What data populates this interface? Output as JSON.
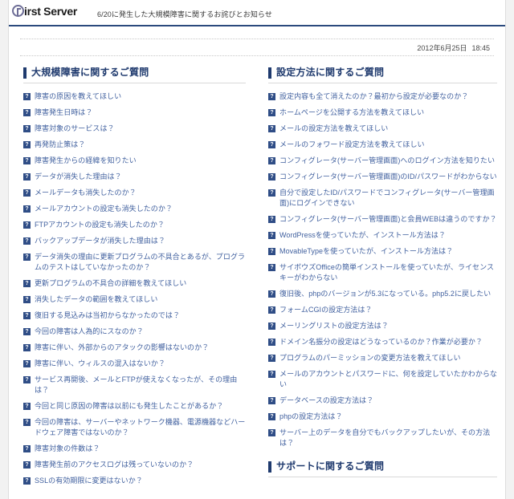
{
  "header": {
    "brand_mark": "first-server-logo",
    "brand_text": "irst Server",
    "title": "6/20に発生した大規模障害に関するお詫びとお知らせ"
  },
  "meta": {
    "date": "2012年6月25日",
    "time": "18:45"
  },
  "icons": {
    "question": "?"
  },
  "sections": {
    "outage": {
      "title": "大規模障害に関するご質問",
      "items": [
        "障害の原因を教えてほしい",
        "障害発生日時は？",
        "障害対象のサービスは？",
        "再発防止策は？",
        "障害発生からの経緯を知りたい",
        "データが消失した理由は？",
        "メールデータも消失したのか？",
        "メールアカウントの設定も消失したのか？",
        "FTPアカウントの設定も消失したのか？",
        "バックアップデータが消失した理由は？",
        "データ消失の理由に更新プログラムの不具合とあるが、プログラムのテストはしていなかったのか？",
        "更新プログラムの不具合の詳細を教えてほしい",
        "消失したデータの範囲を教えてほしい",
        "復旧する見込みは当初からなかったのでは？",
        "今回の障害は人為的にスなのか？",
        "障害に伴い、外部からのアタックの影響はないのか？",
        "障害に伴い、ウィルスの混入はないか？",
        "サービス再開後、メールとFTPが使えなくなったが、その理由は？",
        "今回と同じ原因の障害は以前にも発生したことがあるか？",
        "今回の障害は、サーバーやネットワーク機器、電源機器などハードウェア障害ではないのか？",
        "障害対象の件数は？",
        "障害発生前のアクセスログは残っていないのか？",
        "SSLの有効期限に変更はないか？"
      ]
    },
    "settings": {
      "title": "設定方法に関するご質問",
      "items": [
        "設定内容も全て消えたのか？最初から設定が必要なのか？",
        "ホームページを公開する方法を教えてほしい",
        "メールの設定方法を教えてほしい",
        "メールのフォワード設定方法を教えてほしい",
        "コンフィグレータ(サーバー管理画面)へのログイン方法を知りたい",
        "コンフィグレータ(サーバー管理画面)のID/パスワードがわからない",
        "自分で設定したID/パスワードでコンフィグレータ(サーバー管理画面)にログインできない",
        "コンフィグレータ(サーバー管理画面)と会員WEBは違うのですか？",
        "WordPressを使っていたが、インストール方法は？",
        "MovableTypeを使っていたが、インストール方法は？",
        "サイボウズOfficeの簡単インストールを使っていたが、ライセンスキーがわからない",
        "復旧後、phpのバージョンが5.3になっている。php5.2に戻したい",
        "フォームCGIの設定方法は？",
        "メーリングリストの設定方法は？",
        "ドメイン名振分の設定はどうなっているのか？作業が必要か？",
        "プログラムのパーミッションの変更方法を教えてほしい",
        "メールのアカウントとパスワードに、何を設定していたかわからない",
        "データベースの設定方法は？",
        "phpの設定方法は？",
        "サーバー上のデータを自分でもバックアップしたいが、その方法は？"
      ]
    },
    "support": {
      "title": "サポートに関するご質問",
      "items": []
    }
  },
  "colors": {
    "accent_navy": "#1f3a6e",
    "link_blue": "#3f5f9e",
    "icon_blue": "#2f4d86",
    "page_bg": "#f2f2f2"
  }
}
